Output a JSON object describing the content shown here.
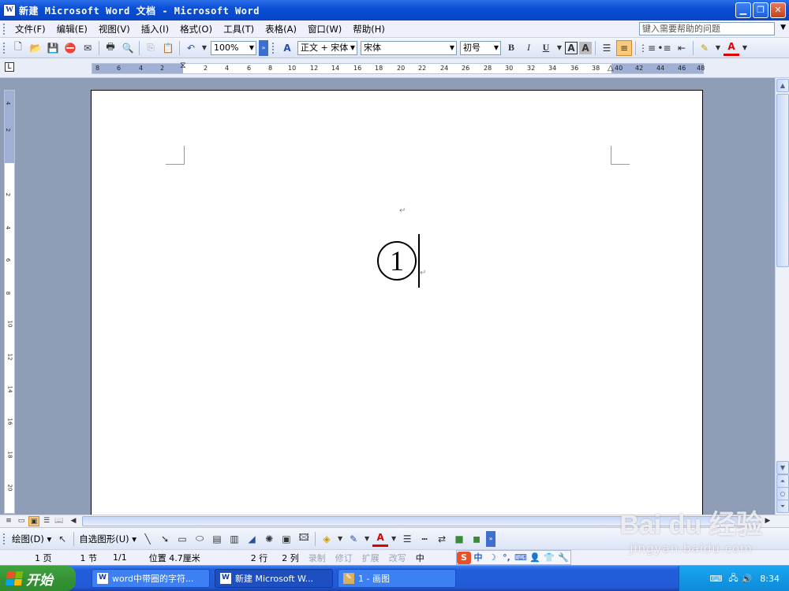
{
  "window": {
    "title": "新建 Microsoft Word 文档 - Microsoft Word",
    "app_icon": "W"
  },
  "menu": {
    "items": [
      "文件(F)",
      "编辑(E)",
      "视图(V)",
      "插入(I)",
      "格式(O)",
      "工具(T)",
      "表格(A)",
      "窗口(W)",
      "帮助(H)"
    ],
    "help_placeholder": "键入需要帮助的问题"
  },
  "toolbar": {
    "zoom": "100%",
    "style": "正文 + 宋体",
    "font": "宋体",
    "size": "初号",
    "bold": "B",
    "italic": "I",
    "underline": "U",
    "char_border": "A",
    "char_shade": "A",
    "font_color": "A"
  },
  "ruler": {
    "corner": "L",
    "h_ticks": [
      "8",
      "6",
      "4",
      "2",
      "2",
      "4",
      "6",
      "8",
      "10",
      "12",
      "14",
      "16",
      "18",
      "20",
      "22",
      "24",
      "26",
      "28",
      "30",
      "32",
      "34",
      "36",
      "38",
      "40",
      "42",
      "44",
      "46",
      "48"
    ],
    "v_ticks": [
      "4",
      "2",
      "2",
      "4",
      "6",
      "8",
      "10",
      "12",
      "14",
      "16",
      "18",
      "20"
    ]
  },
  "document": {
    "para_mark": "↵",
    "enclosed_char": "1"
  },
  "draw_toolbar": {
    "draw_label": "绘图(D) ▾",
    "autoshape_label": "自选图形(U) ▾",
    "font_color": "A"
  },
  "status": {
    "page": "1 页",
    "section": "1 节",
    "pages": "1/1",
    "position": "位置 4.7厘米",
    "line": "2 行",
    "column": "2 列",
    "rec": "录制",
    "trk": "修订",
    "ext": "扩展",
    "ovr": "改写",
    "lang": "中"
  },
  "ime": {
    "logo": "S",
    "mode": "中"
  },
  "taskbar": {
    "start": "开始",
    "tasks": [
      "word中带圈的字符...",
      "新建 Microsoft W...",
      "1 - 画图"
    ],
    "clock": "8:34"
  },
  "watermark": {
    "brand": "Bai du 经验",
    "url": "jingyan.baidu.com"
  }
}
